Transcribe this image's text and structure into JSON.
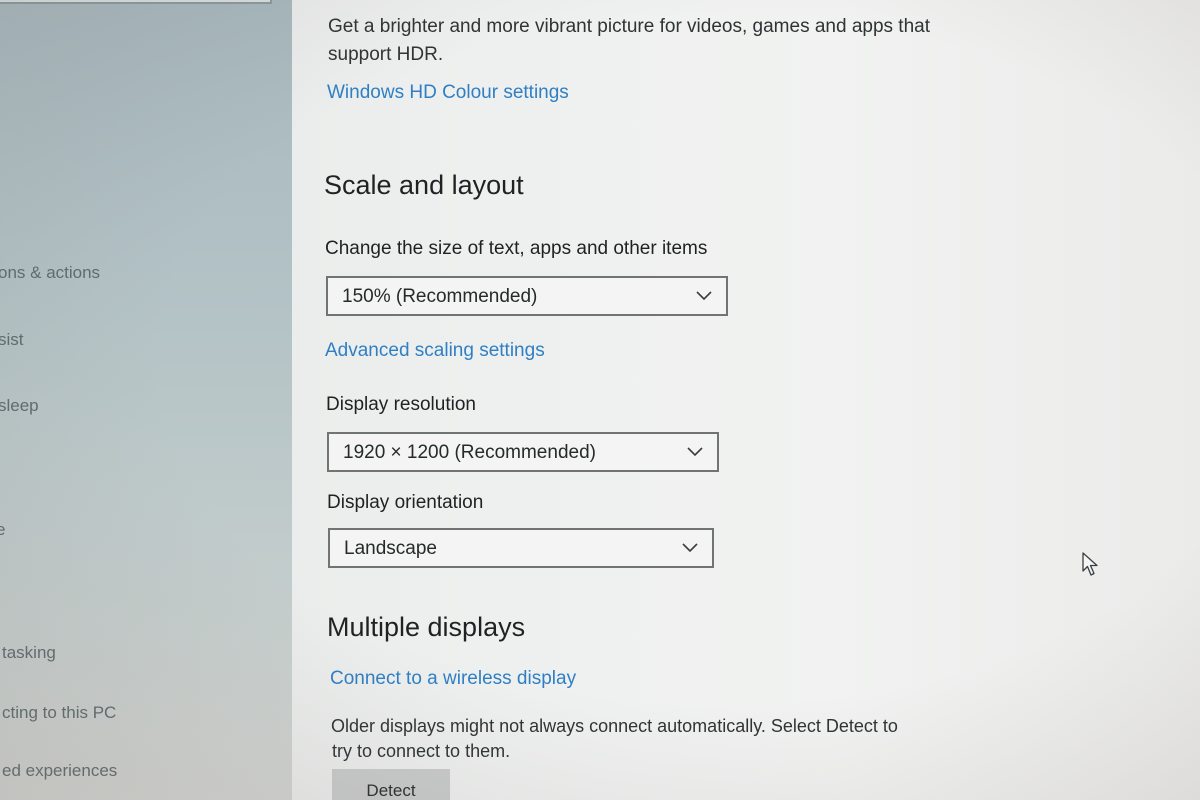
{
  "sidebar": {
    "items": [
      {
        "label": "ons & actions"
      },
      {
        "label": "sist"
      },
      {
        "label": " sleep"
      },
      {
        "label": "e"
      },
      {
        "label": "tasking"
      },
      {
        "label": "cting to this PC"
      },
      {
        "label": "ed experiences"
      }
    ]
  },
  "hdr": {
    "description_line1": "Get a brighter and more vibrant picture for videos, games and apps that",
    "description_line2": "support HDR.",
    "link": "Windows HD Colour settings"
  },
  "scale_layout": {
    "heading": "Scale and layout",
    "size_label": "Change the size of text, apps and other items",
    "size_value": "150% (Recommended)",
    "advanced_link": "Advanced scaling settings",
    "resolution_label": "Display resolution",
    "resolution_value": "1920 × 1200 (Recommended)",
    "orientation_label": "Display orientation",
    "orientation_value": "Landscape"
  },
  "multiple_displays": {
    "heading": "Multiple displays",
    "wireless_link": "Connect to a wireless display",
    "note_line1": "Older displays might not always connect automatically. Select Detect to",
    "note_line2": "try to connect to them.",
    "detect_button": "Detect"
  },
  "colors": {
    "link": "#2f7fc4",
    "sidebar_bg": "#b4c3c6",
    "content_bg": "#eef0ef"
  },
  "icons": [
    "chevron-down-icon",
    "mouse-cursor-icon"
  ]
}
